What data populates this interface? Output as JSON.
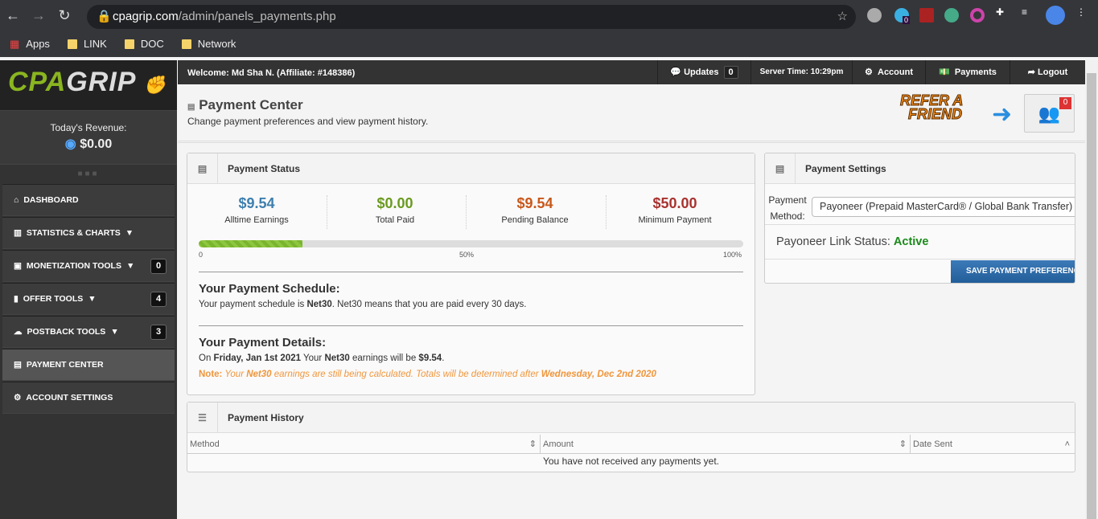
{
  "browser": {
    "url_host": "cpagrip.com",
    "url_path": "/admin/panels_payments.php",
    "ext_badge": "0",
    "bookmarks": [
      "Apps",
      "LINK",
      "DOC",
      "Network"
    ]
  },
  "sidebar": {
    "logo": "CPAGRIP",
    "revenue_label": "Today's Revenue:",
    "revenue_value": "$0.00",
    "items": [
      {
        "label": "DASHBOARD",
        "icon": "home-icon"
      },
      {
        "label": "STATISTICS & CHARTS",
        "icon": "chart-icon",
        "caret": "▼"
      },
      {
        "label": "MONETIZATION TOOLS",
        "icon": "monetization-icon",
        "caret": "▼",
        "badge": "0"
      },
      {
        "label": "OFFER TOOLS",
        "icon": "offer-icon",
        "caret": "▼",
        "badge": "4"
      },
      {
        "label": "POSTBACK TOOLS",
        "icon": "cloud-icon",
        "caret": "▼",
        "badge": "3"
      },
      {
        "label": "PAYMENT CENTER",
        "icon": "money-icon",
        "active": true
      },
      {
        "label": "ACCOUNT SETTINGS",
        "icon": "gear-icon"
      }
    ]
  },
  "topnav": {
    "welcome_prefix": "Welcome: ",
    "welcome": "Md Sha N. (Affiliate: #148386)",
    "updates": "Updates",
    "updates_count": "0",
    "server_time": "Server Time: 10:29pm",
    "account": "Account",
    "payments": "Payments",
    "logout": "Logout"
  },
  "header": {
    "title": "Payment Center",
    "subtitle": "Change payment preferences and view payment history.",
    "refer": "REFER A FRIEND",
    "referrals_count": "0"
  },
  "status": {
    "title": "Payment Status",
    "stats": [
      {
        "value": "$9.54",
        "label": "Alltime Earnings",
        "color": "#3d7fae"
      },
      {
        "value": "$0.00",
        "label": "Total Paid",
        "color": "#6a9a1f"
      },
      {
        "value": "$9.54",
        "label": "Pending Balance",
        "color": "#c8581b"
      },
      {
        "value": "$50.00",
        "label": "Minimum Payment",
        "color": "#a8322f"
      }
    ],
    "progress_percent": 19,
    "ticks": [
      "0",
      "50%",
      "100%"
    ],
    "schedule_title": "Your Payment Schedule:",
    "schedule_pre": "Your payment schedule is ",
    "schedule_bold": "Net30",
    "schedule_post": ". Net30 means that you are paid every 30 days.",
    "details_title": "Your Payment Details:",
    "d1": "On ",
    "d2": "Friday, Jan 1st 2021",
    "d3": " Your ",
    "d4": "Net30",
    "d5": " earnings will be ",
    "d6": "$9.54",
    "d7": ".",
    "n1": "Note:",
    "n2": " Your ",
    "n3": "Net30",
    "n4": " earnings are still being calculated. Totals will be determined after ",
    "n5": "Wednesday, Dec 2nd 2020"
  },
  "settings": {
    "title": "Payment Settings",
    "method_label1": "Payment",
    "method_label2": "Method:",
    "method_value": "Payoneer (Prepaid MasterCard® / Global Bank Transfer)",
    "link_label": "Payoneer Link Status: ",
    "link_value": "Active",
    "save": "SAVE PAYMENT PREFERENCES"
  },
  "history": {
    "title": "Payment History",
    "columns": [
      "Method",
      "Amount",
      "Date Sent"
    ],
    "empty": "You have not received any payments yet."
  }
}
